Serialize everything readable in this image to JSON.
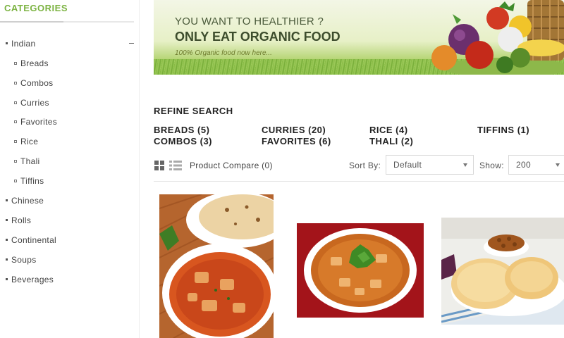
{
  "sidebar": {
    "title": "CATEGORIES",
    "categories": [
      {
        "label": "Indian",
        "level": "top"
      },
      {
        "label": "Breads",
        "level": "sub"
      },
      {
        "label": "Combos",
        "level": "sub"
      },
      {
        "label": "Curries",
        "level": "sub"
      },
      {
        "label": "Favorites",
        "level": "sub"
      },
      {
        "label": "Rice",
        "level": "sub"
      },
      {
        "label": "Thali",
        "level": "sub"
      },
      {
        "label": "Tiffins",
        "level": "sub"
      },
      {
        "label": "Chinese",
        "level": "top"
      },
      {
        "label": "Rolls",
        "level": "top"
      },
      {
        "label": "Continental",
        "level": "top"
      },
      {
        "label": "Soups",
        "level": "top"
      },
      {
        "label": "Beverages",
        "level": "top"
      }
    ]
  },
  "banner": {
    "line1": "YOU WANT TO  HEALTHIER ?",
    "line2": "ONLY EAT ORGANIC FOOD",
    "line3": "100% Organic food now here..."
  },
  "refine": {
    "title": "REFINE SEARCH",
    "links": [
      "BREADS (5)",
      "COMBOS (3)",
      "CURRIES (20)",
      "FAVORITES (6)",
      "RICE (4)",
      "THALI (2)",
      "TIFFINS (1)"
    ]
  },
  "toolbar": {
    "compare": "Product Compare (0)",
    "sort_label": "Sort By:",
    "sort_value": "Default",
    "show_label": "Show:",
    "show_value": "200"
  },
  "colors": {
    "accent": "#7cb342"
  }
}
